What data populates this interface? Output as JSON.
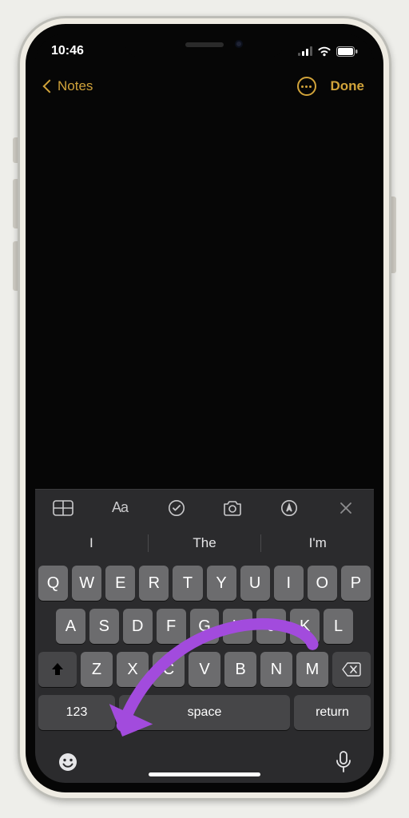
{
  "status": {
    "time": "10:46"
  },
  "nav": {
    "back_label": "Notes",
    "done_label": "Done"
  },
  "toolbar": {
    "aa_label": "Aa"
  },
  "predictions": {
    "slot1": "I",
    "slot2": "The",
    "slot3": "I'm"
  },
  "keyboard": {
    "row1": [
      "Q",
      "W",
      "E",
      "R",
      "T",
      "Y",
      "U",
      "I",
      "O",
      "P"
    ],
    "row2": [
      "A",
      "S",
      "D",
      "F",
      "G",
      "H",
      "J",
      "K",
      "L"
    ],
    "row3": [
      "Z",
      "X",
      "C",
      "V",
      "B",
      "N",
      "M"
    ],
    "num_label": "123",
    "space_label": "space",
    "return_label": "return"
  }
}
